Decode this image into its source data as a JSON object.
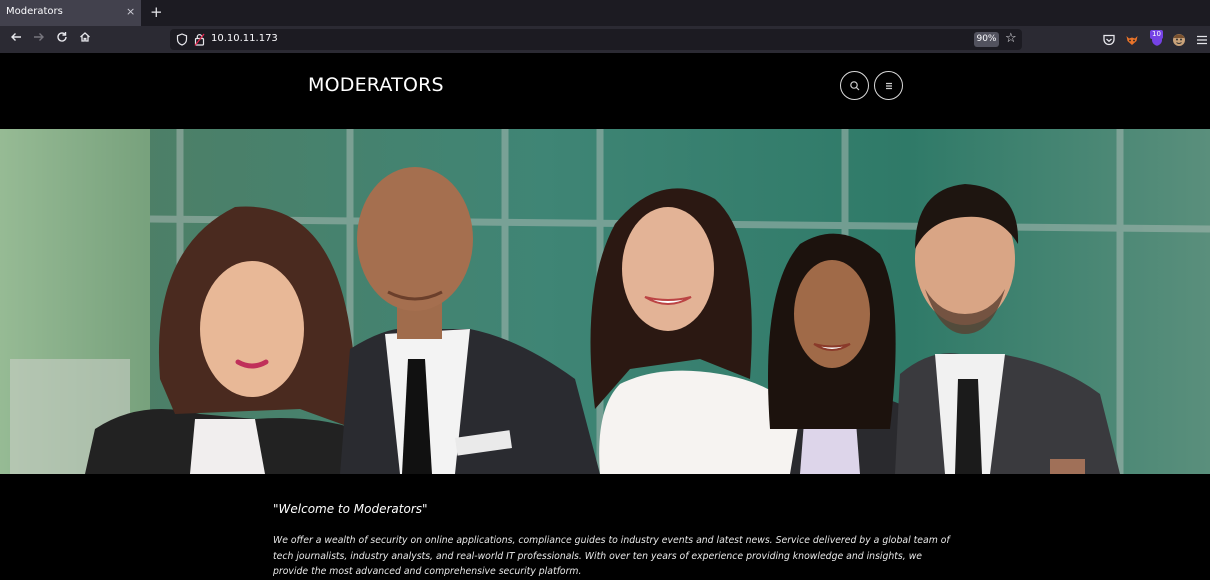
{
  "browser": {
    "tab_title": "Moderators",
    "tab_close_glyph": "×",
    "new_tab_glyph": "+",
    "url": "10.10.11.173",
    "zoom": "90%",
    "extension_badge": "10",
    "icons": [
      "back-icon",
      "forward-icon",
      "reload-icon",
      "home-icon",
      "shield-icon",
      "lock-icon",
      "star-icon",
      "pocket-icon",
      "fox-extension-icon",
      "vpn-extension-icon",
      "avatar-extension-icon",
      "menu-icon"
    ]
  },
  "site": {
    "logo": "MODERATORS",
    "header_icons": [
      "search-icon",
      "menu-icon"
    ]
  },
  "content": {
    "welcome": "\"Welcome to Moderators\"",
    "intro": "We offer a wealth of security on online applications, compliance guides to industry events and latest news. Service delivered by a global team of tech journalists, industry analysts, and real-world IT professionals. With over ten years of experience providing knowledge and insights, we provide the most advanced and comprehensive security platform."
  },
  "colors": {
    "tabbar_bg": "#1c1b22",
    "active_tab_bg": "#42414d",
    "toolbar_bg": "#2b2a33",
    "page_bg": "#000000",
    "text": "#ffffff"
  }
}
